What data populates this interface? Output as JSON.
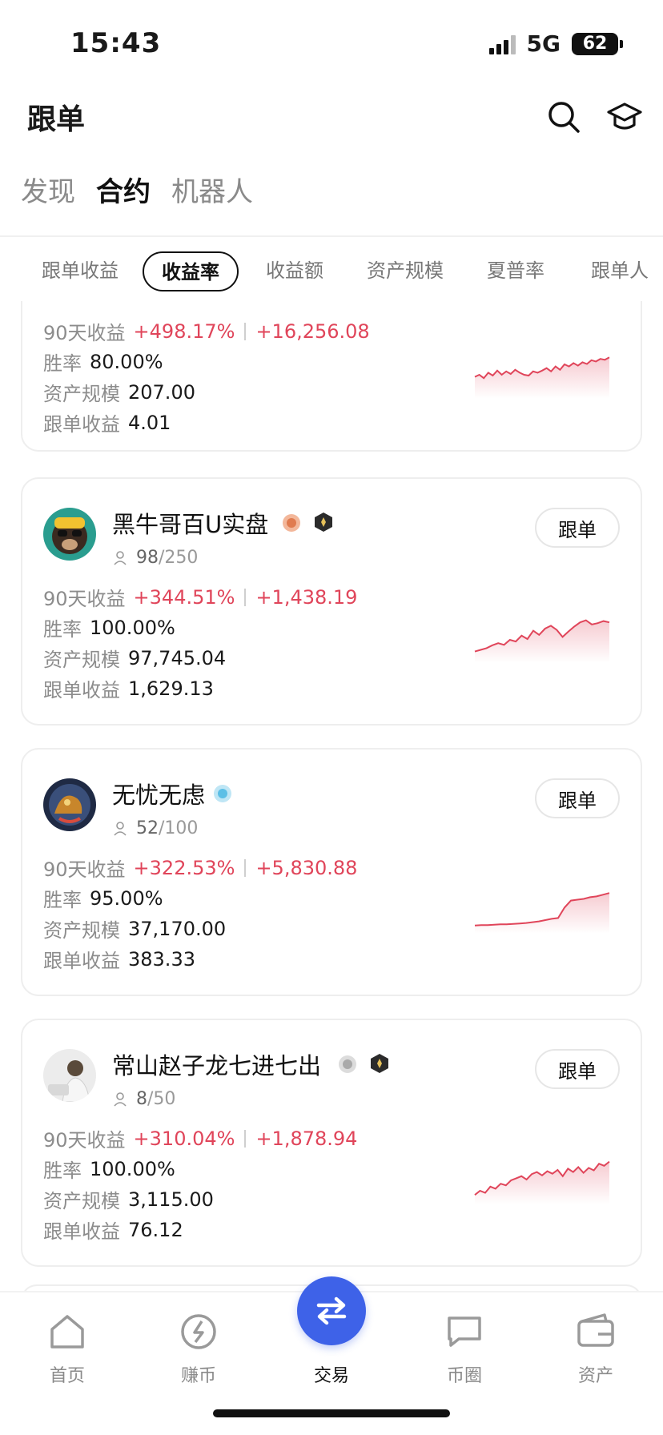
{
  "status": {
    "time": "15:43",
    "network": "5G",
    "battery": "62"
  },
  "header": {
    "title": "跟单"
  },
  "main_tabs": [
    {
      "label": "发现",
      "active": false
    },
    {
      "label": "合约",
      "active": true
    },
    {
      "label": "机器人",
      "active": false
    }
  ],
  "filters": [
    {
      "label": "跟单收益",
      "active": false
    },
    {
      "label": "收益率",
      "active": true
    },
    {
      "label": "收益额",
      "active": false
    },
    {
      "label": "资产规模",
      "active": false
    },
    {
      "label": "夏普率",
      "active": false
    },
    {
      "label": "跟单人",
      "active": false
    }
  ],
  "labels": {
    "ret90": "90天收益",
    "win_rate": "胜率",
    "aum": "资产规模",
    "follow_profit": "跟单收益",
    "follow_btn": "跟单"
  },
  "cards": [
    {
      "name": "",
      "ret_pct": "+498.17%",
      "ret_amt": "+16,256.08",
      "win_rate": "80.00%",
      "aum": "207.00",
      "follow_profit": "4.01",
      "spark": [
        0.45,
        0.5,
        0.42,
        0.55,
        0.48,
        0.6,
        0.5,
        0.58,
        0.52,
        0.62,
        0.55,
        0.5,
        0.48,
        0.58,
        0.55,
        0.6,
        0.66,
        0.58,
        0.7,
        0.62,
        0.75,
        0.7,
        0.78,
        0.72,
        0.8,
        0.76,
        0.85,
        0.82,
        0.88,
        0.86,
        0.92
      ]
    },
    {
      "name": "黑牛哥百U实盘",
      "followers": "98",
      "followers_max": "/250",
      "ret_pct": "+344.51%",
      "ret_amt": "+1,438.19",
      "win_rate": "100.00%",
      "aum": "97,745.04",
      "follow_profit": "1,629.13",
      "spark": [
        0.2,
        0.24,
        0.28,
        0.35,
        0.4,
        0.36,
        0.48,
        0.44,
        0.58,
        0.5,
        0.7,
        0.6,
        0.75,
        0.82,
        0.72,
        0.55,
        0.68,
        0.8,
        0.9,
        0.95,
        0.85,
        0.88,
        0.93,
        0.9
      ]
    },
    {
      "name": "无忧无虑",
      "followers": "52",
      "followers_max": "/100",
      "ret_pct": "+322.53%",
      "ret_amt": "+5,830.88",
      "win_rate": "95.00%",
      "aum": "37,170.00",
      "follow_profit": "383.33",
      "spark": [
        0.12,
        0.13,
        0.13,
        0.14,
        0.15,
        0.15,
        0.16,
        0.17,
        0.18,
        0.2,
        0.22,
        0.25,
        0.28,
        0.3,
        0.55,
        0.72,
        0.74,
        0.76,
        0.8,
        0.82,
        0.86,
        0.9
      ]
    },
    {
      "name": "常山赵子龙七进七出",
      "followers": "8",
      "followers_max": "/50",
      "ret_pct": "+310.04%",
      "ret_amt": "+1,878.94",
      "win_rate": "100.00%",
      "aum": "3,115.00",
      "follow_profit": "76.12",
      "spark": [
        0.15,
        0.25,
        0.2,
        0.35,
        0.3,
        0.42,
        0.38,
        0.5,
        0.55,
        0.6,
        0.52,
        0.65,
        0.7,
        0.62,
        0.72,
        0.66,
        0.75,
        0.6,
        0.78,
        0.7,
        0.82,
        0.68,
        0.8,
        0.74,
        0.9,
        0.85,
        0.95
      ]
    }
  ],
  "nav": [
    {
      "label": "首页",
      "icon": "home-icon"
    },
    {
      "label": "赚币",
      "icon": "earn-icon"
    },
    {
      "label": "交易",
      "icon": "trade-icon"
    },
    {
      "label": "币圈",
      "icon": "feed-icon"
    },
    {
      "label": "资产",
      "icon": "wallet-icon"
    }
  ],
  "colors": {
    "accent": "#3e62e8",
    "profit": "#e0455a"
  }
}
